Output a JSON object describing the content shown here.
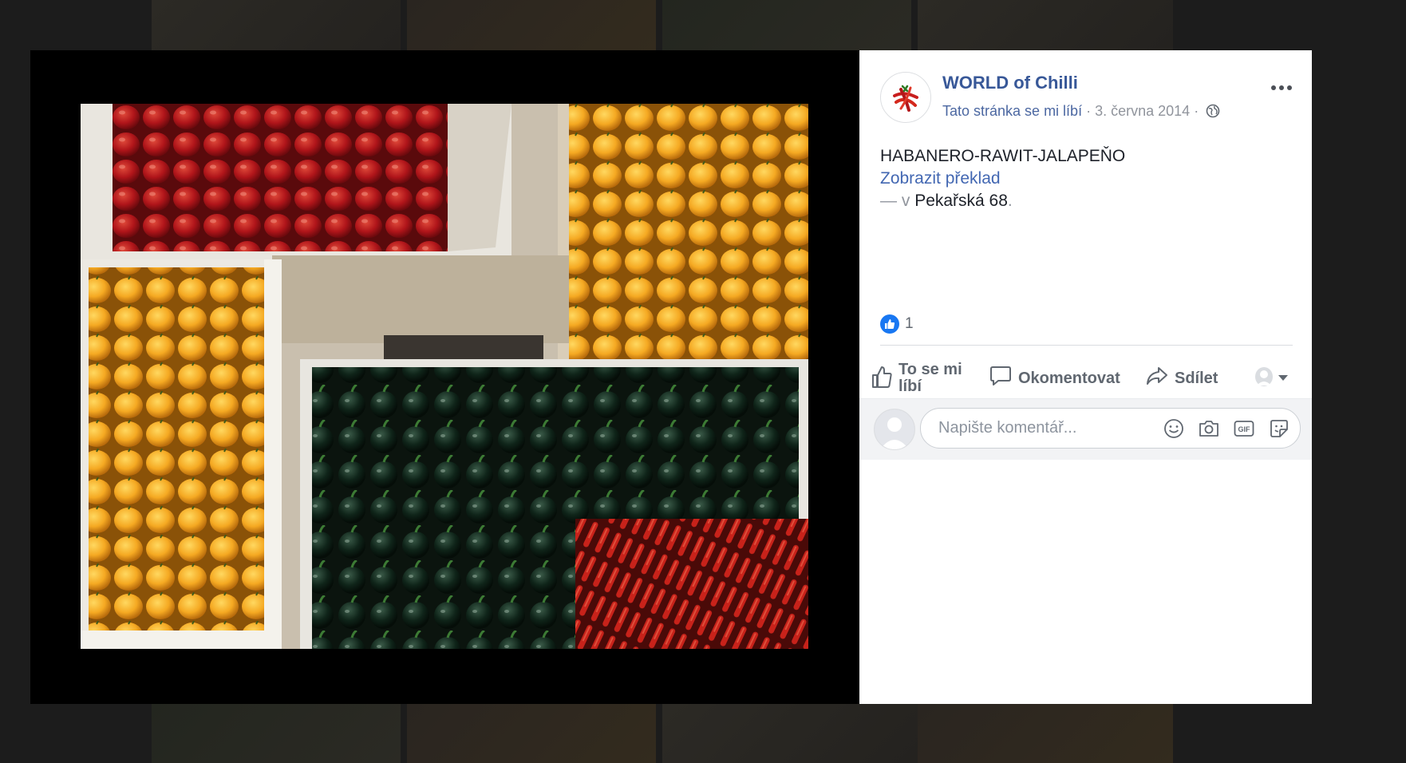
{
  "post": {
    "page_name": "WORLD of Chilli",
    "like_page_label": "Tato stránka se mi líbí",
    "separator": "·",
    "date": "3. června 2014",
    "text": "HABANERO-RAWIT-JALAPEŇO",
    "translate_label": "Zobrazit překlad",
    "location_prefix": "— v",
    "location": "Pekařská 68",
    "location_suffix": "."
  },
  "reactions": {
    "count": "1"
  },
  "actions": {
    "like_label": "To se mi líbí",
    "comment_label": "Okomentovat",
    "share_label": "Sdílet"
  },
  "comment": {
    "placeholder": "Napište komentář..."
  },
  "icons": {
    "more": "more-options-icon",
    "globe": "globe-icon",
    "like_badge": "like-reaction-icon",
    "like": "thumbs-up-icon",
    "comment": "comment-bubble-icon",
    "share": "share-arrow-icon",
    "audience": "audience-avatar-icon",
    "emoji": "emoji-icon",
    "camera": "camera-icon",
    "gif": "gif-icon",
    "sticker": "sticker-icon"
  },
  "colors": {
    "link": "#385898",
    "accent": "#1877f2",
    "muted": "#90949c"
  }
}
